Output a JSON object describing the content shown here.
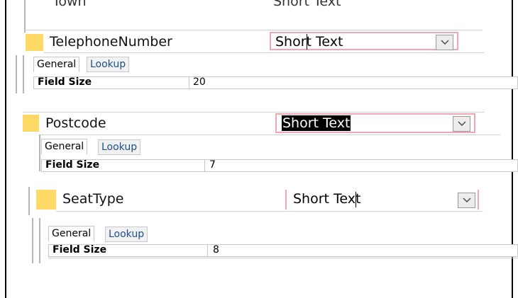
{
  "fields": [
    {
      "name": "Town",
      "type": "Short Text",
      "partial": true
    },
    {
      "name": "TelephoneNumber",
      "type": "Short Text",
      "type_highlighted": false,
      "tabs": {
        "general": "General",
        "lookup": "Lookup"
      },
      "properties": [
        {
          "label": "Field Size",
          "value": "20"
        }
      ]
    },
    {
      "name": "Postcode",
      "type": "Short Text",
      "type_highlighted": true,
      "tabs": {
        "general": "General",
        "lookup": "Lookup"
      },
      "properties": [
        {
          "label": "Field Size",
          "value": "7"
        }
      ]
    },
    {
      "name": "SeatType",
      "type": "Short Text",
      "type_highlighted": false,
      "tabs": {
        "general": "General",
        "lookup": "Lookup"
      },
      "properties": [
        {
          "label": "Field Size",
          "value": "8"
        }
      ]
    }
  ],
  "colors": {
    "row_selector": "#ffd966",
    "active_cell_border": "#f0a8b4",
    "tab_link": "#1a4f8a"
  },
  "icons": {
    "dropdown": "chevron-down-icon"
  }
}
